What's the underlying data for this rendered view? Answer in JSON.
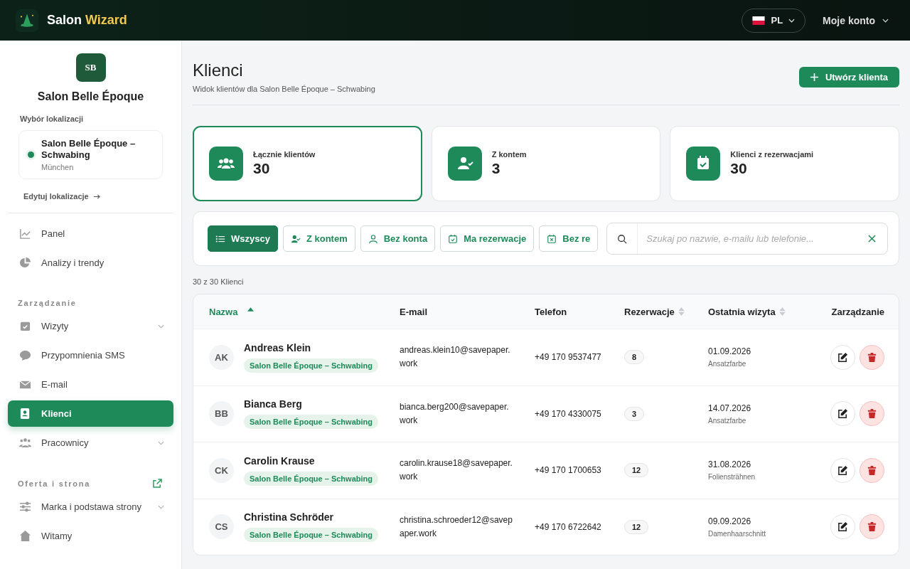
{
  "header": {
    "brand_first": "Salon",
    "brand_second": "Wizard",
    "language": "PL",
    "account": "Moje konto"
  },
  "sidebar": {
    "logo_text": "SB",
    "salon_name": "Salon Belle Époque",
    "location_label": "Wybór lokalizacji",
    "location": {
      "name": "Salon Belle Époque – Schwabing",
      "city": "München",
      "selected": true
    },
    "edit_link": "Edytuj lokalizacje",
    "groups": [
      {
        "items": [
          {
            "label": "Panel",
            "selected": false,
            "expandable": false
          },
          {
            "label": "Analizy i trendy",
            "selected": false,
            "expandable": false
          }
        ]
      },
      {
        "title": "Zarządzanie",
        "items": [
          {
            "label": "Wizyty",
            "selected": false,
            "expandable": true
          },
          {
            "label": "Przypomnienia SMS",
            "selected": false,
            "expandable": false
          },
          {
            "label": "E-mail",
            "selected": false,
            "expandable": false
          },
          {
            "label": "Klienci",
            "selected": true,
            "expandable": false
          },
          {
            "label": "Pracownicy",
            "selected": false,
            "expandable": true
          }
        ]
      },
      {
        "title": "Oferta i strona",
        "external": true,
        "items": [
          {
            "label": "Marka i podstawa strony",
            "selected": false,
            "expandable": true
          },
          {
            "label": "Witamy",
            "selected": false,
            "expandable": false
          }
        ]
      }
    ]
  },
  "page": {
    "title": "Klienci",
    "subtitle": "Widok klientów dla Salon Belle Époque – Schwabing",
    "create_button": "Utwórz klienta"
  },
  "stats": [
    {
      "label": "Łącznie klientów",
      "value": "30",
      "selected": true
    },
    {
      "label": "Z kontem",
      "value": "3",
      "selected": false
    },
    {
      "label": "Klienci z rezerwacjami",
      "value": "30",
      "selected": false
    }
  ],
  "filters": [
    {
      "label": "Wszyscy",
      "selected": true
    },
    {
      "label": "Z kontem",
      "selected": false
    },
    {
      "label": "Bez konta",
      "selected": false
    },
    {
      "label": "Ma rezerwacje",
      "selected": false
    },
    {
      "label": "Bez re",
      "selected": false
    }
  ],
  "search": {
    "placeholder": "Szukaj po nazwie, e-mailu lub telefonie..."
  },
  "count": "30 z 30 Klienci",
  "table": {
    "columns": [
      {
        "label": "Nazwa",
        "sortable": true,
        "sorted": true
      },
      {
        "label": "E-mail",
        "sortable": false,
        "sorted": false
      },
      {
        "label": "Telefon",
        "sortable": false,
        "sorted": false
      },
      {
        "label": "Rezerwacje",
        "sortable": true,
        "sorted": false
      },
      {
        "label": "Ostatnia wizyta",
        "sortable": true,
        "sorted": false
      },
      {
        "label": "Zarządzanie",
        "sortable": false,
        "sorted": false
      }
    ],
    "rows": [
      {
        "initials": "AK",
        "name": "Andreas Klein",
        "location": "Salon Belle Époque – Schwabing",
        "email": "andreas.klein10@savepaper.work",
        "phone": "+49 170 9537477",
        "bookings": "8",
        "last_visit": "01.09.2026",
        "service": "Ansatzfarbe"
      },
      {
        "initials": "BB",
        "name": "Bianca Berg",
        "location": "Salon Belle Époque – Schwabing",
        "email": "bianca.berg200@savepaper.work",
        "phone": "+49 170 4330075",
        "bookings": "3",
        "last_visit": "14.07.2026",
        "service": "Ansatzfarbe"
      },
      {
        "initials": "CK",
        "name": "Carolin Krause",
        "location": "Salon Belle Époque – Schwabing",
        "email": "carolin.krause18@savepaper.work",
        "phone": "+49 170 1700653",
        "bookings": "12",
        "last_visit": "31.08.2026",
        "service": "Foliensträhnen"
      },
      {
        "initials": "CS",
        "name": "Christina Schröder",
        "location": "Salon Belle Époque – Schwabing",
        "email": "christina.schroeder12@savepaper.work",
        "phone": "+49 170 6722642",
        "bookings": "12",
        "last_visit": "09.09.2026",
        "service": "Damenhaarschnitt"
      }
    ]
  }
}
